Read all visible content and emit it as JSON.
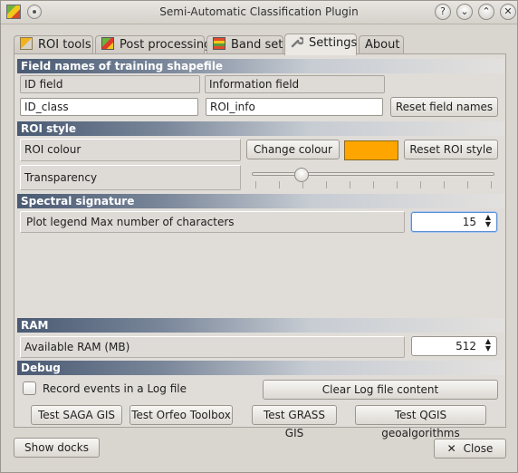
{
  "window": {
    "title": "Semi-Automatic Classification Plugin",
    "buttons": {
      "help": "?",
      "minimize": "⌄",
      "maximize": "⌃",
      "close": "✕"
    }
  },
  "tabs": [
    {
      "label": "ROI tools",
      "icon": "roi-tools-icon"
    },
    {
      "label": "Post processing",
      "icon": "post-processing-icon"
    },
    {
      "label": "Band set",
      "icon": "band-set-icon"
    },
    {
      "label": "Settings",
      "icon": "wrench-icon",
      "active": true
    },
    {
      "label": "About"
    }
  ],
  "field_names": {
    "header": "Field names of training shapefile",
    "id_label": "ID field",
    "info_label": "Information field",
    "id_value": "ID_class",
    "info_value": "ROI_info",
    "reset_button": "Reset field names"
  },
  "roi_style": {
    "header": "ROI style",
    "colour_label": "ROI colour",
    "change_colour_button": "Change colour",
    "colour": "#ffa500",
    "reset_button": "Reset ROI style",
    "transparency_label": "Transparency",
    "transparency_value": 0.2
  },
  "spectral": {
    "header": "Spectral signature",
    "legend_label": "Plot legend Max number of characters",
    "legend_value": "15"
  },
  "ram": {
    "header": "RAM",
    "label": "Available RAM (MB)",
    "value": "512"
  },
  "debug": {
    "header": "Debug",
    "record_label": "Record events in a Log file",
    "record_checked": false,
    "clear_button": "Clear Log file content",
    "test_buttons": [
      "Test SAGA GIS",
      "Test Orfeo Toolbox",
      "Test GRASS GIS",
      "Test QGIS geoalgorithms"
    ]
  },
  "footer": {
    "show_docks": "Show docks",
    "close_button": "Close",
    "close_icon": "✕"
  },
  "colors": {
    "header_start": "#4a5a73",
    "accent_focus": "#5b8fd6"
  }
}
